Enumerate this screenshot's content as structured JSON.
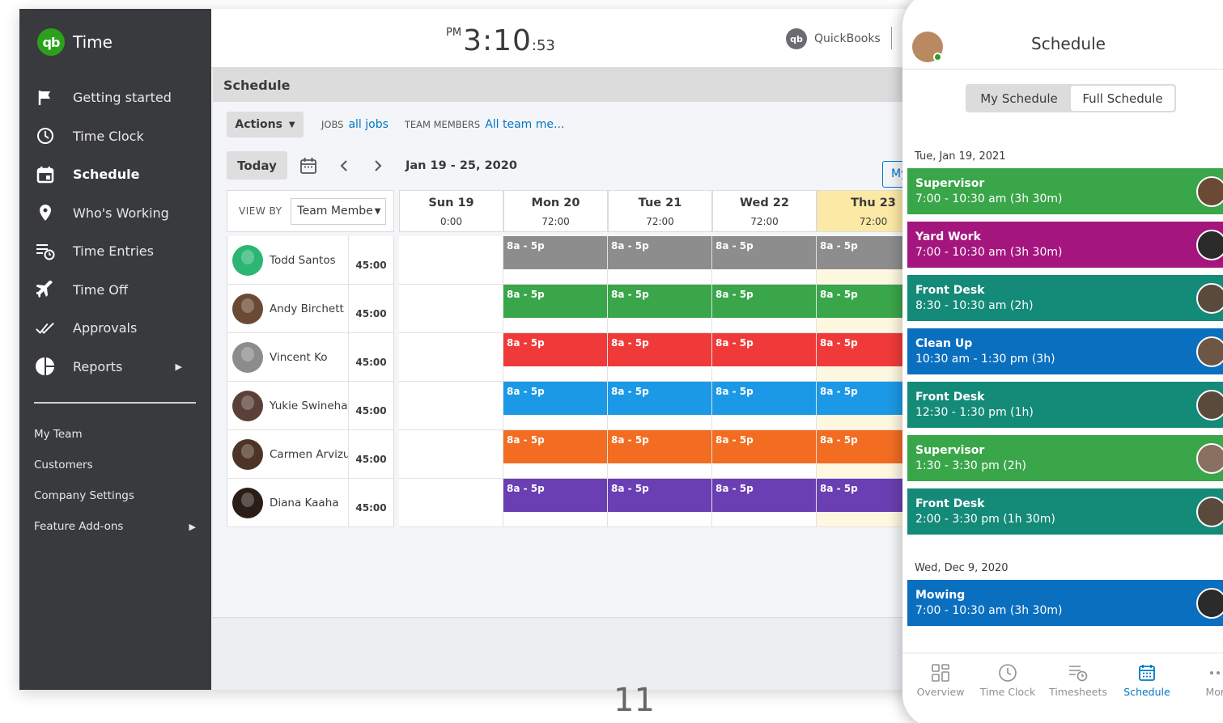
{
  "app": {
    "logo_text": "qb",
    "name": "Time"
  },
  "sidebar": {
    "nav": [
      {
        "label": "Getting started",
        "icon": "flag-icon"
      },
      {
        "label": "Time Clock",
        "icon": "clock-icon"
      },
      {
        "label": "Schedule",
        "icon": "calendar-icon",
        "active": true
      },
      {
        "label": "Who's Working",
        "icon": "location-pin-icon"
      },
      {
        "label": "Time Entries",
        "icon": "time-entries-icon"
      },
      {
        "label": "Time Off",
        "icon": "airplane-icon"
      },
      {
        "label": "Approvals",
        "icon": "double-check-icon"
      },
      {
        "label": "Reports",
        "icon": "pie-chart-icon",
        "has_submenu": true
      }
    ],
    "secondary": [
      {
        "label": "My Team"
      },
      {
        "label": "Customers"
      },
      {
        "label": "Company Settings"
      },
      {
        "label": "Feature Add-ons",
        "has_submenu": true
      }
    ]
  },
  "topbar": {
    "clock_ampm": "PM",
    "clock_time": "3:10",
    "clock_seconds": ":53",
    "brand_label": "QuickBooks"
  },
  "schedule": {
    "title": "Schedule",
    "actions_label": "Actions",
    "jobs_label": "JOBS",
    "jobs_value": "all jobs",
    "team_label": "TEAM MEMBERS",
    "team_value": "All team me...",
    "today_label": "Today",
    "date_range": "Jan 19 - 25, 2020",
    "my_toggle": "My",
    "view_by_label": "VIEW BY",
    "view_by_value": "Team Membe",
    "days": [
      {
        "name": "Sun 19",
        "hours": "0:00",
        "today": false
      },
      {
        "name": "Mon 20",
        "hours": "72:00",
        "today": false
      },
      {
        "name": "Tue 21",
        "hours": "72:00",
        "today": false
      },
      {
        "name": "Wed 22",
        "hours": "72:00",
        "today": false
      },
      {
        "name": "Thu 23",
        "hours": "72:00",
        "today": true
      }
    ],
    "shift_label": "8a - 5p",
    "members": [
      {
        "name": "Todd Santos",
        "hours": "45:00",
        "color": "#8d8d8d",
        "avatar_color": "#2bb673"
      },
      {
        "name": "Andy Birchett",
        "hours": "45:00",
        "color": "#3aa64a",
        "avatar_color": "#6b4a35"
      },
      {
        "name": "Vincent Ko",
        "hours": "45:00",
        "color": "#f03a3a",
        "avatar_color": "#8c8c8c"
      },
      {
        "name": "Yukie Swinehart",
        "hours": "45:00",
        "color": "#1b99e6",
        "avatar_color": "#5a4038"
      },
      {
        "name": "Carmen Arvizu",
        "hours": "45:00",
        "color": "#f26d22",
        "avatar_color": "#4d3426"
      },
      {
        "name": "Diana Kaaha",
        "hours": "45:00",
        "color": "#6a3fb3",
        "avatar_color": "#2b1e17"
      }
    ]
  },
  "page_number": "11",
  "phone": {
    "title": "Schedule",
    "tabs": [
      "My Schedule",
      "Full Schedule"
    ],
    "active_tab": "Full Schedule",
    "groups": [
      {
        "date": "Tue, Jan 19, 2021",
        "shifts": [
          {
            "role": "Supervisor",
            "time": "7:00 - 10:30 am (3h 30m)",
            "color": "#3aa64a",
            "avatar_color": "#6b4a35"
          },
          {
            "role": "Yard Work",
            "time": "7:00 - 10:30 am (3h 30m)",
            "color": "#a4157d",
            "avatar_color": "#2b2b2b"
          },
          {
            "role": "Front Desk",
            "time": "8:30 - 10:30 am (2h)",
            "color": "#148a78",
            "avatar_color": "#5a4a3c"
          },
          {
            "role": "Clean Up",
            "time": "10:30 am - 1:30 pm (3h)",
            "color": "#0b6fc0",
            "avatar_color": "#6e5644"
          },
          {
            "role": "Front Desk",
            "time": "12:30 - 1:30 pm (1h)",
            "color": "#148a78",
            "avatar_color": "#5a4a3c"
          },
          {
            "role": "Supervisor",
            "time": "1:30 - 3:30 pm (2h)",
            "color": "#3aa64a",
            "avatar_color": "#8a7060"
          },
          {
            "role": "Front Desk",
            "time": "2:00 - 3:30 pm (1h 30m)",
            "color": "#148a78",
            "avatar_color": "#5a4a3c"
          }
        ]
      },
      {
        "date": "Wed, Dec 9, 2020",
        "shifts": [
          {
            "role": "Mowing",
            "time": "7:00 - 10:30 am (3h 30m)",
            "color": "#0b6fc0",
            "avatar_color": "#2b2b2b"
          }
        ]
      }
    ],
    "bottom_nav": [
      {
        "label": "Overview",
        "icon": "overview-grid-icon"
      },
      {
        "label": "Time Clock",
        "icon": "clock-icon"
      },
      {
        "label": "Timesheets",
        "icon": "timesheets-icon"
      },
      {
        "label": "Schedule",
        "icon": "calendar-icon",
        "active": true
      },
      {
        "label": "More",
        "icon": "more-dots-icon"
      }
    ]
  }
}
